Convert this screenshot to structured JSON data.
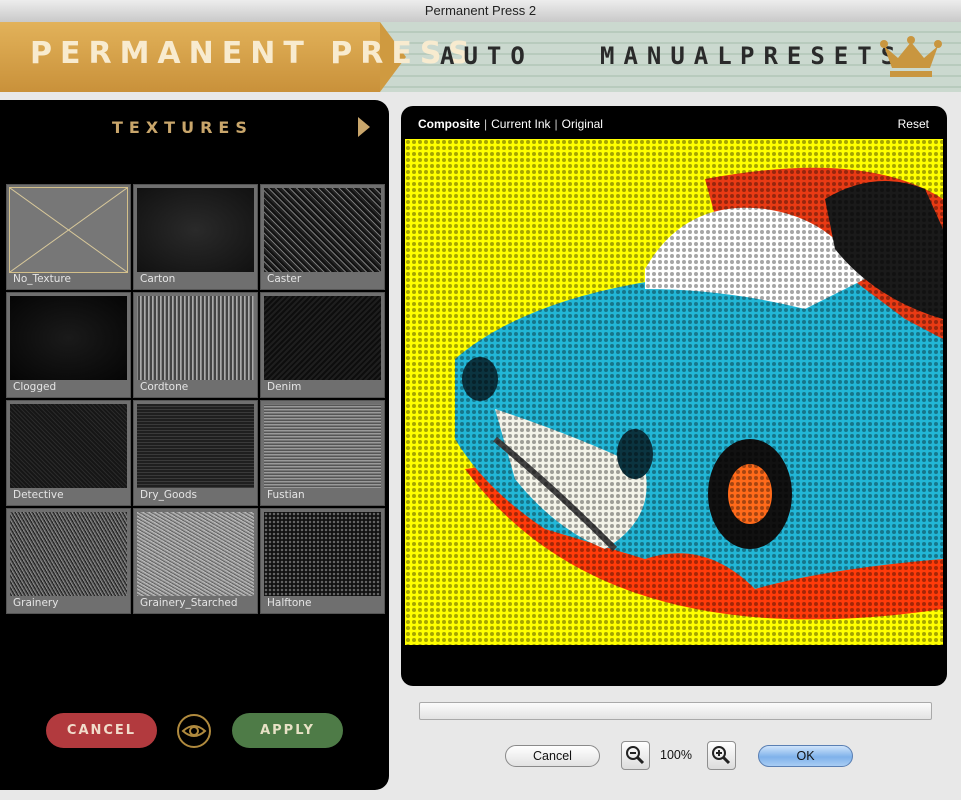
{
  "window": {
    "title": "Permanent Press 2"
  },
  "header": {
    "brand": "PERMANENT PRESS",
    "nav": [
      "AUTO",
      "MANUAL",
      "PRESETS"
    ],
    "crown_icon": "crown-icon",
    "colors": {
      "gold": "#d7a34c",
      "stripe": "#c4d5c9"
    }
  },
  "textures": {
    "title": "TEXTURES",
    "items": [
      {
        "label": "No_Texture",
        "selected": true
      },
      {
        "label": "Carton"
      },
      {
        "label": "Caster"
      },
      {
        "label": "Clogged"
      },
      {
        "label": "Cordtone"
      },
      {
        "label": "Denim"
      },
      {
        "label": "Detective"
      },
      {
        "label": "Dry_Goods"
      },
      {
        "label": "Fustian"
      },
      {
        "label": "Grainery"
      },
      {
        "label": "Grainery_Starched"
      },
      {
        "label": "Halftone"
      }
    ],
    "cancel_label": "CANCEL",
    "apply_label": "APPLY",
    "preview_icon": "eye-icon"
  },
  "preview": {
    "tabs": [
      "Composite",
      "Current Ink",
      "Original"
    ],
    "active_tab": "Composite",
    "reset_label": "Reset"
  },
  "footer": {
    "cancel_label": "Cancel",
    "zoom": "100%",
    "ok_label": "OK"
  }
}
